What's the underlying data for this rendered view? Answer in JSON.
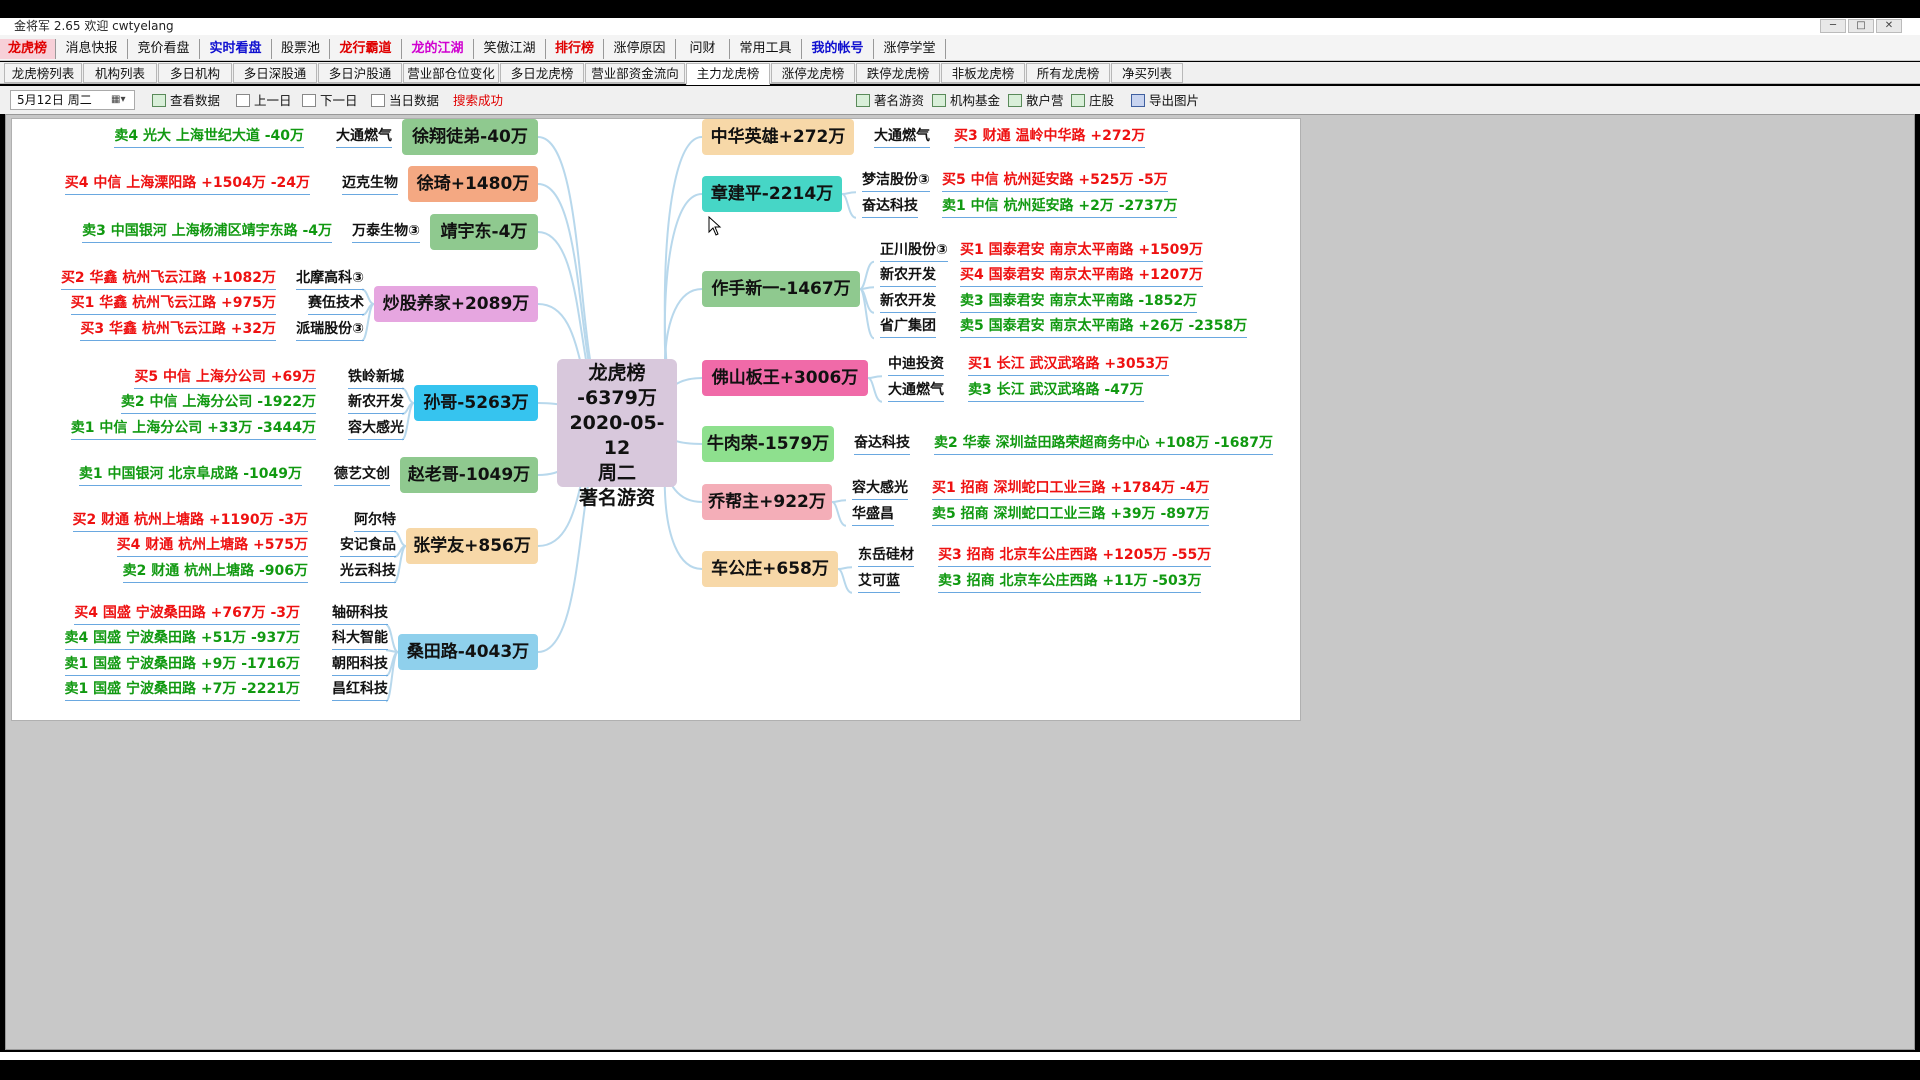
{
  "window": {
    "title": "金将军 2.65 欢迎 cwtyelang"
  },
  "menu": [
    {
      "label": "龙虎榜",
      "style": "active"
    },
    {
      "label": "消息快报",
      "style": ""
    },
    {
      "label": "竞价看盘",
      "style": ""
    },
    {
      "label": "实时看盘",
      "style": "blue"
    },
    {
      "label": "股票池",
      "style": ""
    },
    {
      "label": "龙行霸道",
      "style": "red"
    },
    {
      "label": "龙的江湖",
      "style": "magenta"
    },
    {
      "label": "笑傲江湖",
      "style": ""
    },
    {
      "label": "排行榜",
      "style": "red"
    },
    {
      "label": "涨停原因",
      "style": ""
    },
    {
      "label": "问财",
      "style": ""
    },
    {
      "label": "常用工具",
      "style": ""
    },
    {
      "label": "我的帐号",
      "style": "blue"
    },
    {
      "label": "涨停学堂",
      "style": ""
    }
  ],
  "tabs": [
    {
      "label": "龙虎榜列表",
      "active": false
    },
    {
      "label": "机构列表",
      "active": false
    },
    {
      "label": "多日机构",
      "active": false
    },
    {
      "label": "多日深股通",
      "active": false
    },
    {
      "label": "多日沪股通",
      "active": false
    },
    {
      "label": "营业部仓位变化",
      "active": false
    },
    {
      "label": "多日龙虎榜",
      "active": false
    },
    {
      "label": "营业部资金流向",
      "active": false
    },
    {
      "label": "主力龙虎榜",
      "active": true
    },
    {
      "label": "涨停龙虎榜",
      "active": false
    },
    {
      "label": "跌停龙虎榜",
      "active": false
    },
    {
      "label": "非板龙虎榜",
      "active": false
    },
    {
      "label": "所有龙虎榜",
      "active": false
    },
    {
      "label": "净买列表",
      "active": false
    }
  ],
  "toolbar": {
    "date": "5月12日 周二",
    "view_data": "查看数据",
    "prev_day": "上一日",
    "next_day": "下一日",
    "today_data": "当日数据",
    "search_status": "搜索成功",
    "filters": [
      "著名游资",
      "机构基金",
      "散户营",
      "庄股"
    ],
    "export": "导出图片"
  },
  "mindmap": {
    "center": [
      "龙虎榜",
      "-6379万",
      "2020-05-12",
      "周二",
      "著名游资"
    ],
    "left": [
      {
        "name": "徐翔徒弟-40万",
        "color": "#8fc98f",
        "rows": [
          {
            "detail": "卖4 光大 上海世纪大道 -40万",
            "kind": "green",
            "stock": "大通燃气"
          }
        ]
      },
      {
        "name": "徐琦+1480万",
        "color": "#f4a882",
        "rows": [
          {
            "detail": "买4 中信 上海溧阳路 +1504万 -24万",
            "kind": "red",
            "stock": "迈克生物"
          }
        ]
      },
      {
        "name": "靖宇东-4万",
        "color": "#8fc98f",
        "rows": [
          {
            "detail": "卖3 中国银河 上海杨浦区靖宇东路 -4万",
            "kind": "green",
            "stock": "万泰生物③"
          }
        ]
      },
      {
        "name": "炒股养家+2089万",
        "color": "#e6a6e0",
        "rows": [
          {
            "detail": "买2 华鑫 杭州飞云江路 +1082万",
            "kind": "red",
            "stock": "北摩高科③"
          },
          {
            "detail": "买1 华鑫 杭州飞云江路 +975万",
            "kind": "red",
            "stock": "赛伍技术"
          },
          {
            "detail": "买3 华鑫 杭州飞云江路 +32万",
            "kind": "red",
            "stock": "派瑞股份③"
          }
        ]
      },
      {
        "name": "孙哥-5263万",
        "color": "#36c4ef",
        "rows": [
          {
            "detail": "买5 中信 上海分公司 +69万",
            "kind": "red",
            "stock": "铁岭新城"
          },
          {
            "detail": "卖2 中信 上海分公司 -1922万",
            "kind": "green",
            "stock": "新农开发"
          },
          {
            "detail": "卖1 中信 上海分公司 +33万 -3444万",
            "kind": "green",
            "stock": "容大感光"
          }
        ]
      },
      {
        "name": "赵老哥-1049万",
        "color": "#8fc98f",
        "rows": [
          {
            "detail": "卖1 中国银河 北京阜成路 -1049万",
            "kind": "green",
            "stock": "德艺文创"
          }
        ]
      },
      {
        "name": "张学友+856万",
        "color": "#f7d8a8",
        "rows": [
          {
            "detail": "买2 财通 杭州上塘路 +1190万 -3万",
            "kind": "red",
            "stock": "阿尔特"
          },
          {
            "detail": "买4 财通 杭州上塘路 +575万",
            "kind": "red",
            "stock": "安记食品"
          },
          {
            "detail": "卖2 财通 杭州上塘路 -906万",
            "kind": "green",
            "stock": "光云科技"
          }
        ]
      },
      {
        "name": "桑田路-4043万",
        "color": "#8fd0ec",
        "rows": [
          {
            "detail": "买4 国盛 宁波桑田路 +767万 -3万",
            "kind": "red",
            "stock": "轴研科技"
          },
          {
            "detail": "卖4 国盛 宁波桑田路 +51万 -937万",
            "kind": "green",
            "stock": "科大智能"
          },
          {
            "detail": "卖1 国盛 宁波桑田路 +9万 -1716万",
            "kind": "green",
            "stock": "朝阳科技"
          },
          {
            "detail": "卖1 国盛 宁波桑田路 +7万 -2221万",
            "kind": "green",
            "stock": "昌红科技"
          }
        ]
      }
    ],
    "right": [
      {
        "name": "中华英雄+272万",
        "color": "#f7d8a8",
        "rows": [
          {
            "stock": "大通燃气",
            "detail": "买3 财通 温岭中华路 +272万",
            "kind": "red"
          }
        ]
      },
      {
        "name": "章建平-2214万",
        "color": "#46d6c6",
        "rows": [
          {
            "stock": "梦洁股份③",
            "detail": "买5 中信 杭州延安路 +525万 -5万",
            "kind": "red"
          },
          {
            "stock": "奋达科技",
            "detail": "卖1 中信 杭州延安路 +2万 -2737万",
            "kind": "green"
          }
        ]
      },
      {
        "name": "作手新一-1467万",
        "color": "#8fc98f",
        "rows": [
          {
            "stock": "正川股份③",
            "detail": "买1 国泰君安 南京太平南路 +1509万",
            "kind": "red"
          },
          {
            "stock": "新农开发",
            "detail": "买4 国泰君安 南京太平南路 +1207万",
            "kind": "red"
          },
          {
            "stock": "新农开发",
            "detail": "卖3 国泰君安 南京太平南路 -1852万",
            "kind": "green"
          },
          {
            "stock": "省广集团",
            "detail": "卖5 国泰君安 南京太平南路 +26万 -2358万",
            "kind": "green"
          }
        ]
      },
      {
        "name": "佛山板王+3006万",
        "color": "#f06aa8",
        "rows": [
          {
            "stock": "中迪投资",
            "detail": "买1 长江 武汉武珞路 +3053万",
            "kind": "red"
          },
          {
            "stock": "大通燃气",
            "detail": "卖3 长江 武汉武珞路 -47万",
            "kind": "green"
          }
        ]
      },
      {
        "name": "牛肉荣-1579万",
        "color": "#8ee08e",
        "rows": [
          {
            "stock": "奋达科技",
            "detail": "卖2 华泰 深圳益田路荣超商务中心 +108万 -1687万",
            "kind": "green"
          }
        ]
      },
      {
        "name": "乔帮主+922万",
        "color": "#f4aeb8",
        "rows": [
          {
            "stock": "容大感光",
            "detail": "买1 招商 深圳蛇口工业三路 +1784万 -4万",
            "kind": "red"
          },
          {
            "stock": "华盛昌",
            "detail": "卖5 招商 深圳蛇口工业三路 +39万 -897万",
            "kind": "green"
          }
        ]
      },
      {
        "name": "车公庄+658万",
        "color": "#f7d8a8",
        "rows": [
          {
            "stock": "东岳硅材",
            "detail": "买3 招商 北京车公庄西路 +1205万 -55万",
            "kind": "red"
          },
          {
            "stock": "艾可蓝",
            "detail": "卖3 招商 北京车公庄西路 +11万 -503万",
            "kind": "green"
          }
        ]
      }
    ]
  }
}
